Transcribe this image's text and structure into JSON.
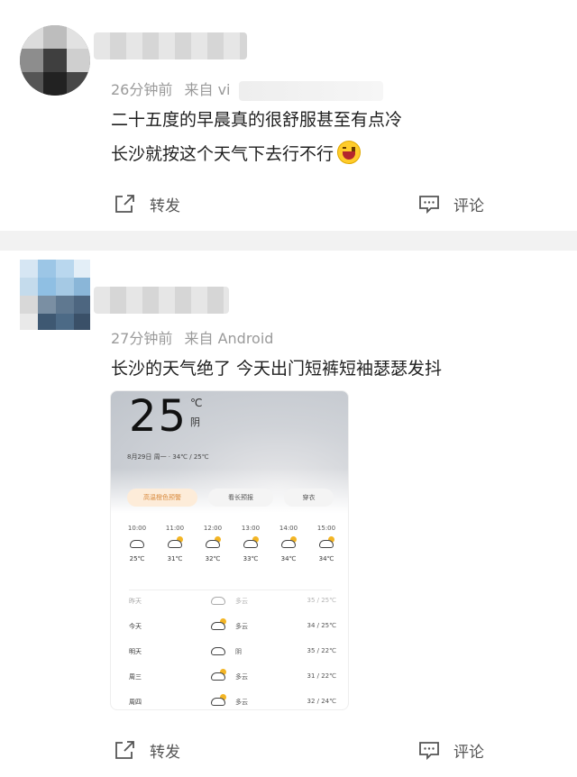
{
  "posts": [
    {
      "time": "26分钟前",
      "from_label": "来自",
      "source": "vi",
      "lines": [
        "二十五度的早晨真的很舒服甚至有点冷",
        "长沙就按这个天气下去行不行"
      ],
      "share_label": "转发",
      "comment_label": "评论"
    },
    {
      "time": "27分钟前",
      "from_label": "来自",
      "source": "Android",
      "lines": [
        "长沙的天气绝了 今天出门短裤短袖瑟瑟发抖"
      ],
      "share_label": "转发",
      "comment_label": "评论",
      "weather": {
        "temp": "25",
        "unit": "℃",
        "condition": "阴",
        "date_line": "8月29日 周一 · 34℃ / 25℃",
        "pills": [
          "高温橙色预警",
          "看长预报",
          "穿衣"
        ],
        "hours": [
          {
            "time": "10:00",
            "temp": "25℃"
          },
          {
            "time": "11:00",
            "temp": "31℃"
          },
          {
            "time": "12:00",
            "temp": "32℃"
          },
          {
            "time": "13:00",
            "temp": "33℃"
          },
          {
            "time": "14:00",
            "temp": "34℃"
          },
          {
            "time": "15:00",
            "temp": "34℃"
          }
        ],
        "days": [
          {
            "name": "昨天",
            "cond": "多云",
            "range": "35 / 25℃"
          },
          {
            "name": "今天",
            "cond": "多云",
            "range": "34 / 25℃"
          },
          {
            "name": "明天",
            "cond": "阴",
            "range": "35 / 22℃"
          },
          {
            "name": "周三",
            "cond": "多云",
            "range": "31 / 22℃"
          },
          {
            "name": "周四",
            "cond": "多云",
            "range": "32 / 24℃"
          }
        ]
      }
    }
  ],
  "colors": {
    "meta": "#9a9a9a",
    "separator": "#f2f2f2",
    "accent_orange": "#d88a3d"
  },
  "icons": {
    "share": "share-icon",
    "comment": "comment-icon"
  }
}
